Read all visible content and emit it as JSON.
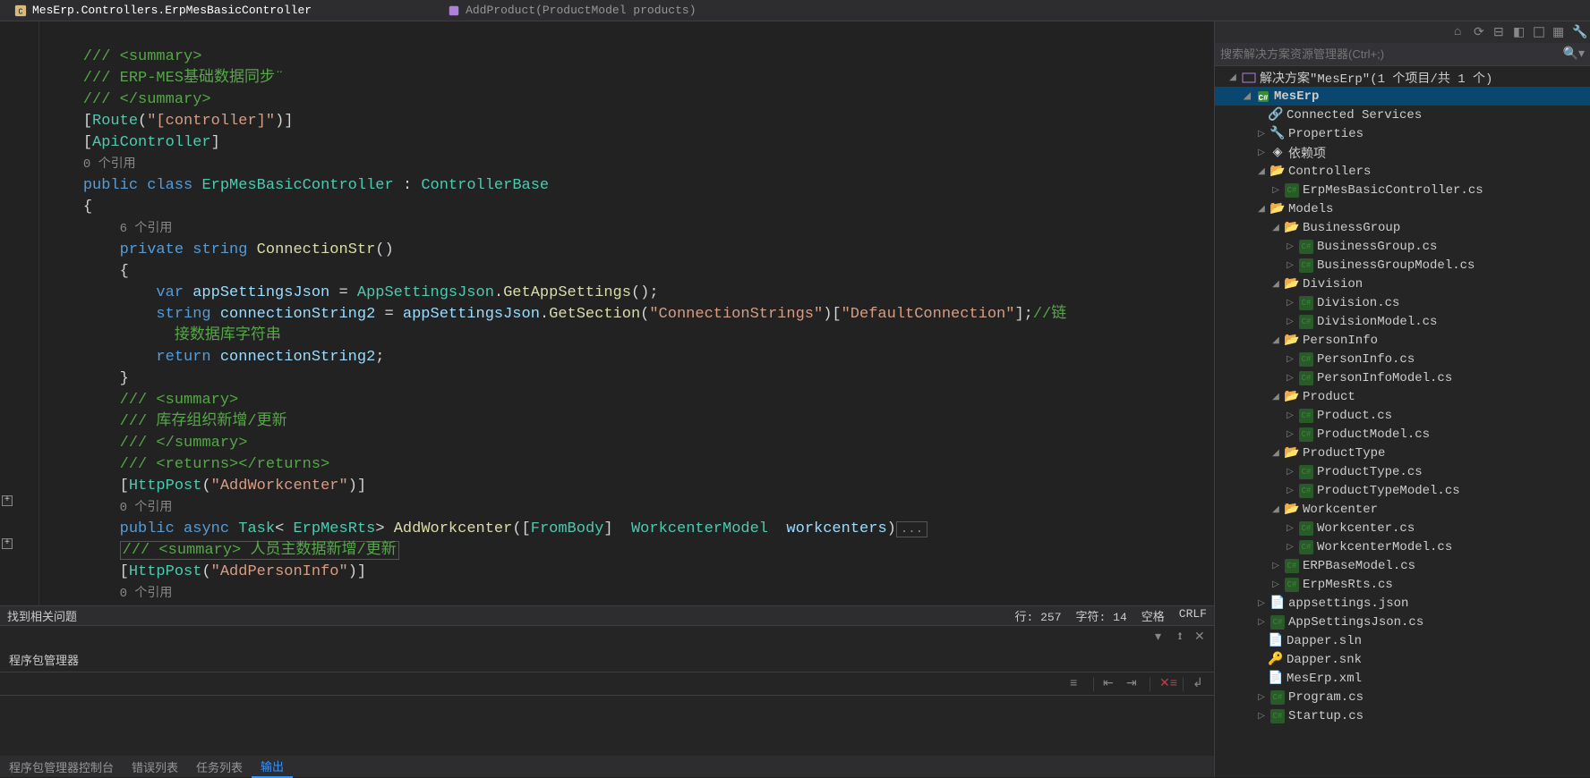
{
  "tabs": {
    "left": "MesErp.Controllers.ErpMesBasicController",
    "right": "AddProduct(ProductModel products)"
  },
  "code": {
    "l1_comment": "    /// <summary>",
    "l2_comment": "    /// ERP-MES基础数据同步¨",
    "l3_comment": "    /// </summary>",
    "l4_route_attr": "Route",
    "l4_route_str": "\"[controller]\"",
    "l5_api_attr": "ApiController",
    "l6_ref": "0 个引用",
    "l7_public": "public",
    "l7_class": "class",
    "l7_name": "ErpMesBasicController",
    "l7_colon": " : ",
    "l7_base": "ControllerBase",
    "l8_brace": "{",
    "l9_ref": "6 个引用",
    "l10_private": "private",
    "l10_string": "string",
    "l10_name": "ConnectionStr",
    "l11_brace": "{",
    "l12_var": "var",
    "l12_local": "appSettingsJson",
    "l12_eq": " = ",
    "l12_type": "AppSettingsJson",
    "l12_dot": ".",
    "l12_method": "GetAppSettings",
    "l12_end": "();",
    "l13_string": "string",
    "l13_local": "connectionString2",
    "l13_eq": " = ",
    "l13_obj": "appSettingsJson",
    "l13_dot": ".",
    "l13_method": "GetSection",
    "l13_p1": "(",
    "l13_str1": "\"ConnectionStrings\"",
    "l13_p2": ")[",
    "l13_str2": "\"DefaultConnection\"",
    "l13_p3": "];",
    "l13_comment": "//链",
    "l14_comment": "接数据库字符串",
    "l15_return": "return",
    "l15_local": "connectionString2",
    "l15_end": ";",
    "l16_brace": "}",
    "l17_comment": "/// <summary>",
    "l18_comment": "/// 库存组织新增/更新",
    "l19_comment": "/// </summary>",
    "l20_comment": "/// <returns></returns>",
    "l21_attr": "HttpPost",
    "l21_str": "\"AddWorkcenter\"",
    "l22_ref": "0 个引用",
    "l23_public": "public",
    "l23_async": "async",
    "l23_task": "Task",
    "l23_lt": "< ",
    "l23_rts": "ErpMesRts",
    "l23_gt": "> ",
    "l23_method": "AddWorkcenter",
    "l23_p1": "([",
    "l23_frombody": "FromBody",
    "l23_p2": "]  ",
    "l23_type": "WorkcenterModel",
    "l23_sp": "  ",
    "l23_param": "workcenters",
    "l23_p3": ")",
    "l23_ellipsis": "...",
    "l24_comment": "/// <summary> 人员主数据新增/更新",
    "l25_attr": "HttpPost",
    "l25_str": "\"AddPersonInfo\"",
    "l26_ref": "0 个引用"
  },
  "status": {
    "left": "找到相关问题",
    "line": "行: 257",
    "col": "字符: 14",
    "ws": "空格",
    "nl": "CRLF"
  },
  "panel": {
    "title": "程序包管理器",
    "tabs": {
      "t1": "程序包管理器控制台",
      "t2": "错误列表",
      "t3": "任务列表",
      "t4": "输出"
    }
  },
  "se": {
    "search_placeholder": "搜索解决方案资源管理器(Ctrl+;)",
    "solution": "解决方案\"MesErp\"(1 个项目/共 1 个)",
    "project": "MesErp",
    "connected": "Connected Services",
    "properties": "Properties",
    "deps": "依赖项",
    "controllers": "Controllers",
    "ctrl_file": "ErpMesBasicController.cs",
    "models": "Models",
    "bg_folder": "BusinessGroup",
    "bg1": "BusinessGroup.cs",
    "bg2": "BusinessGroupModel.cs",
    "div_folder": "Division",
    "div1": "Division.cs",
    "div2": "DivisionModel.cs",
    "pi_folder": "PersonInfo",
    "pi1": "PersonInfo.cs",
    "pi2": "PersonInfoModel.cs",
    "prod_folder": "Product",
    "prod1": "Product.cs",
    "prod2": "ProductModel.cs",
    "pt_folder": "ProductType",
    "pt1": "ProductType.cs",
    "pt2": "ProductTypeModel.cs",
    "wc_folder": "Workcenter",
    "wc1": "Workcenter.cs",
    "wc2": "WorkcenterModel.cs",
    "erpbase": "ERPBaseModel.cs",
    "erprts": "ErpMesRts.cs",
    "appsettings": "appsettings.json",
    "appsettingsjson": "AppSettingsJson.cs",
    "dapper_sln": "Dapper.sln",
    "dapper_snk": "Dapper.snk",
    "meserp_xml": "MesErp.xml",
    "program": "Program.cs",
    "startup": "Startup.cs"
  }
}
